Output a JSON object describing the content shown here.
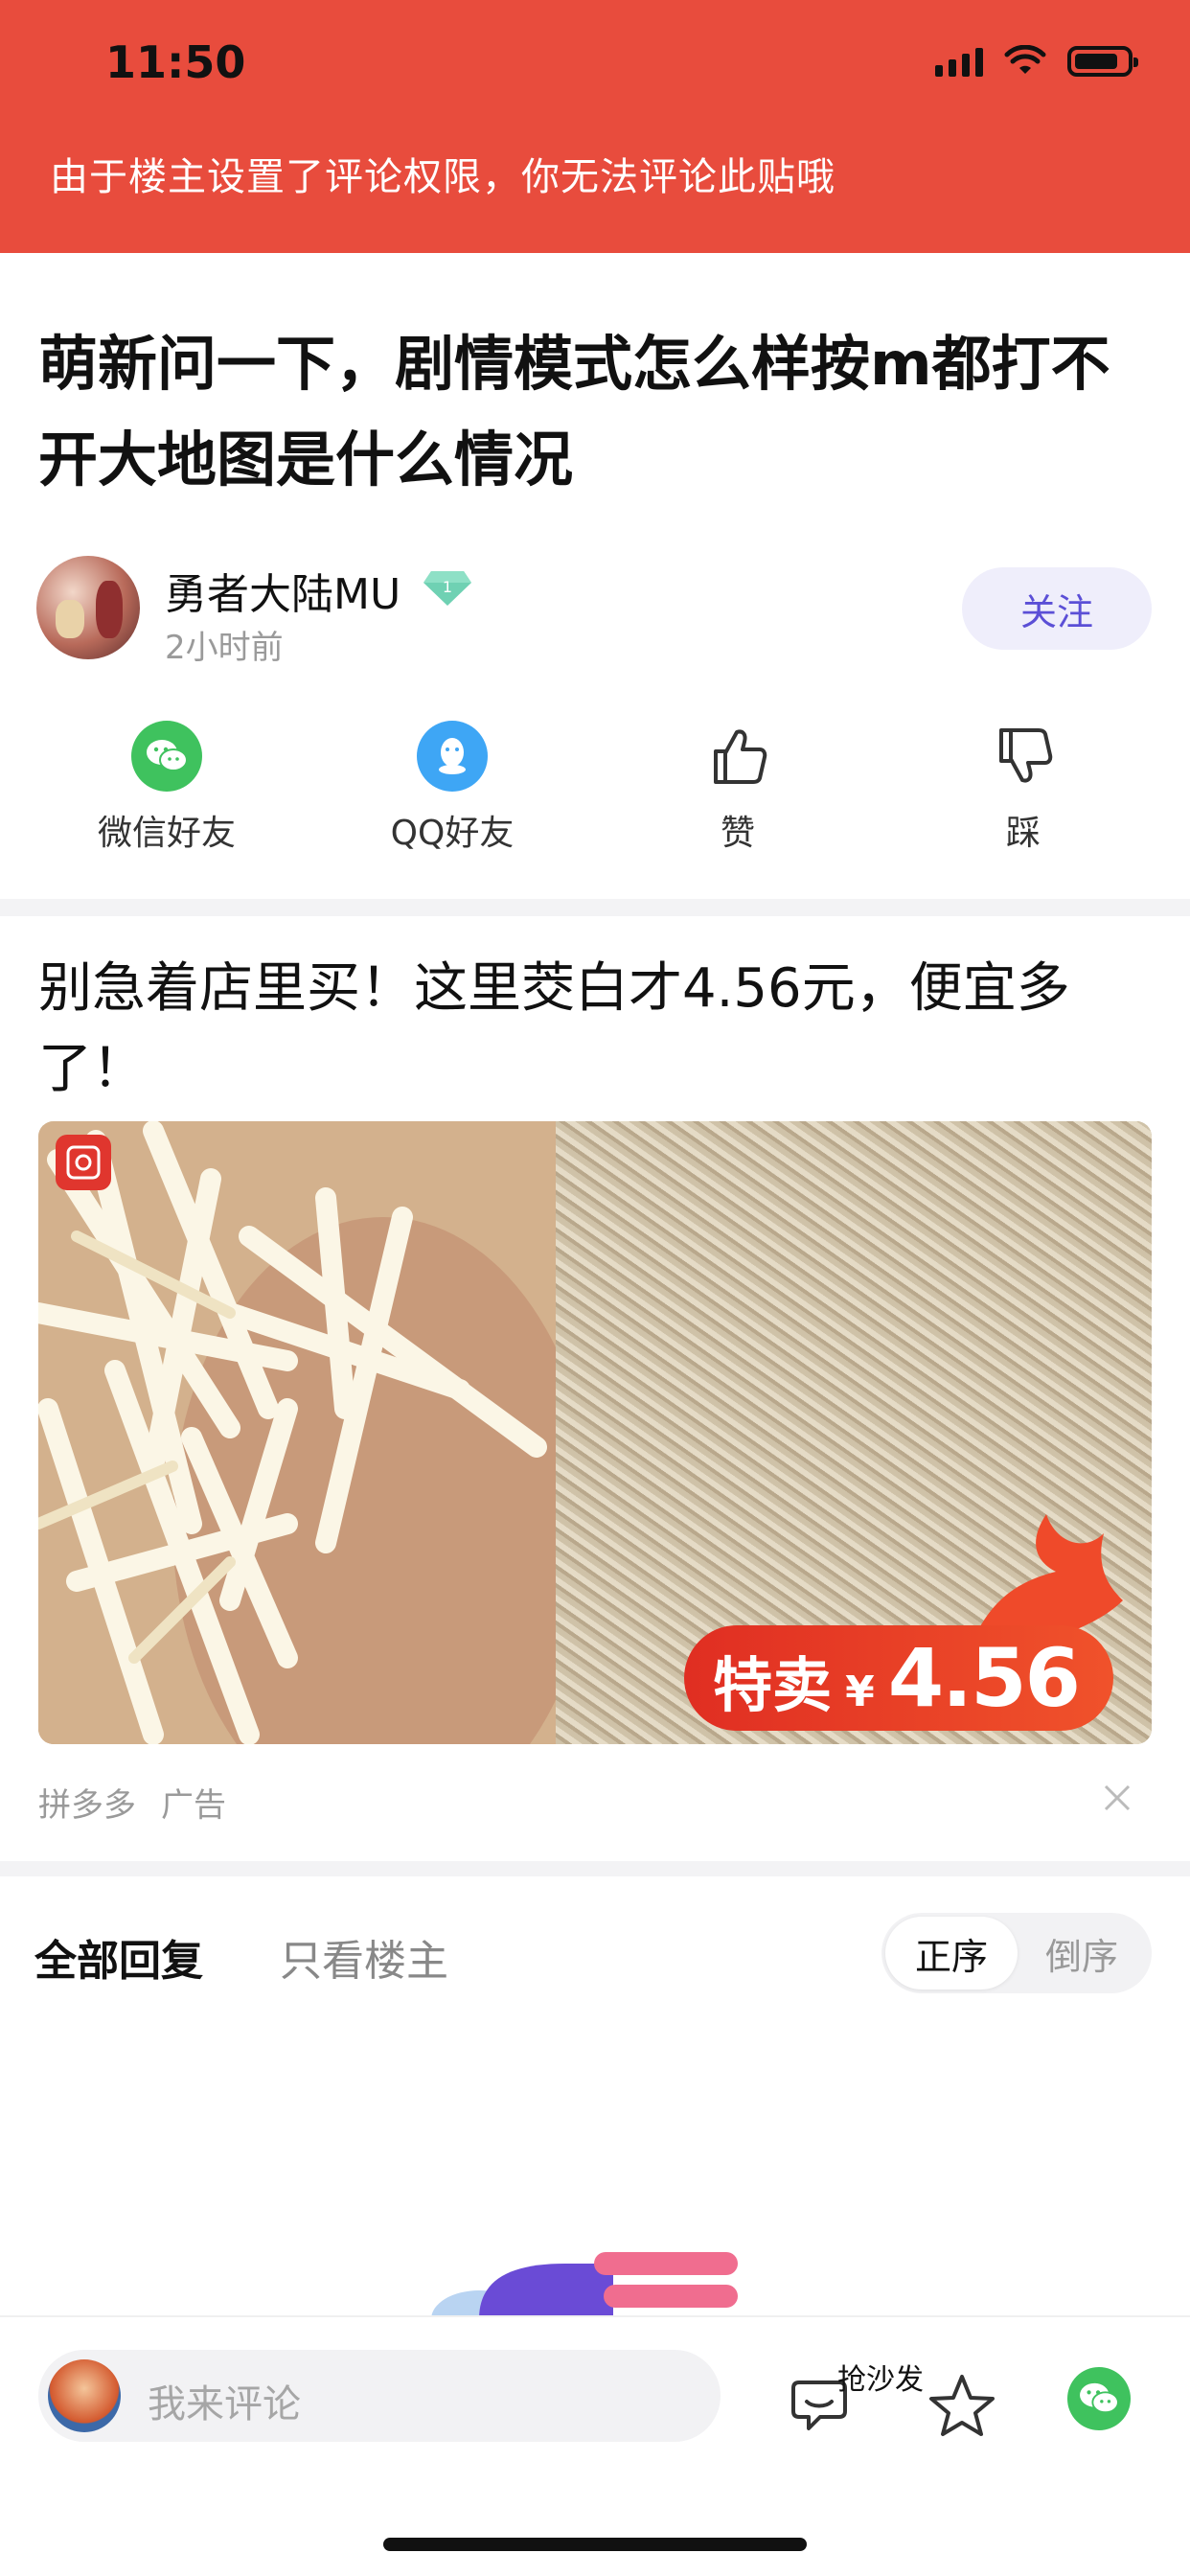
{
  "status_bar": {
    "time": "11:50"
  },
  "banner": {
    "text": "由于楼主设置了评论权限，你无法评论此贴哦"
  },
  "post": {
    "title": "萌新问一下，剧情模式怎么样按m都打不开大地图是什么情况",
    "author": {
      "name": "勇者大陆MU",
      "level_badge": "1",
      "time": "2小时前"
    },
    "follow_label": "关注"
  },
  "share": [
    {
      "label": "微信好友",
      "icon": "wechat-icon",
      "color": "#3fc25e"
    },
    {
      "label": "QQ好友",
      "icon": "qq-icon",
      "color": "#3ea6f5"
    },
    {
      "label": "赞",
      "icon": "thumbs-up-icon"
    },
    {
      "label": "踩",
      "icon": "thumbs-down-icon"
    }
  ],
  "ad": {
    "title": "别急着店里买！这里茭白才4.56元，便宜多了！",
    "price_label": "特卖",
    "currency": "¥",
    "price": "4.56",
    "source": "拼多多",
    "tag": "广告"
  },
  "tabs": {
    "all_replies": "全部回复",
    "owner_only": "只看楼主",
    "sort_asc": "正序",
    "sort_desc": "倒序"
  },
  "bottom_bar": {
    "comment_placeholder": "我来评论",
    "sofa_label": "抢沙发"
  },
  "colors": {
    "banner": "#e84c3d",
    "accent": "#5b4fd6",
    "wechat": "#3fc25e",
    "qq": "#3ea6f5",
    "price_tag": "#e02e22"
  }
}
